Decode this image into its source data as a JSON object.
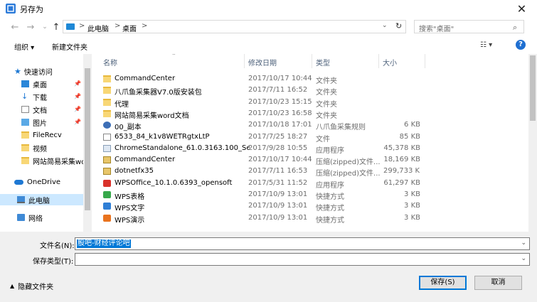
{
  "window": {
    "title": "另存为",
    "close_glyph": "✕"
  },
  "address": {
    "path": [
      "此电脑",
      "桌面"
    ],
    "sep": ">"
  },
  "search": {
    "placeholder": "搜索\"桌面\""
  },
  "toolbar": {
    "organize": "组织 ▾",
    "new_folder": "新建文件夹",
    "view_glyph": "☷ ▾",
    "help_glyph": "?"
  },
  "nav_pane": {
    "items": [
      {
        "label": "快速访问",
        "icon": "star-icon"
      },
      {
        "label": "桌面",
        "icon": "desktop-icon",
        "pinned": true
      },
      {
        "label": "下载",
        "icon": "download-icon",
        "pinned": true
      },
      {
        "label": "文档",
        "icon": "document-icon",
        "pinned": true
      },
      {
        "label": "图片",
        "icon": "pictures-icon",
        "pinned": true
      },
      {
        "label": "FileRecv",
        "icon": "folder-icon"
      },
      {
        "label": "视频",
        "icon": "folder-icon"
      },
      {
        "label": "网站简易采集wc",
        "icon": "folder-icon"
      },
      {
        "label": "OneDrive",
        "icon": "onedrive-icon"
      },
      {
        "label": "此电脑",
        "icon": "this-pc-icon",
        "selected": true
      },
      {
        "label": "网络",
        "icon": "network-icon"
      }
    ]
  },
  "columns": {
    "name": "名称",
    "date": "修改日期",
    "type": "类型",
    "size": "大小"
  },
  "files": [
    {
      "name": "CommandCenter",
      "date": "2017/10/17 10:44",
      "type": "文件夹",
      "size": "",
      "icon": "folder"
    },
    {
      "name": "八爪鱼采集器V7.0版安装包",
      "date": "2017/7/11 16:52",
      "type": "文件夹",
      "size": "",
      "icon": "folder"
    },
    {
      "name": "代理",
      "date": "2017/10/23 15:15",
      "type": "文件夹",
      "size": "",
      "icon": "folder"
    },
    {
      "name": "网站简易采集word文档",
      "date": "2017/10/23 16:58",
      "type": "文件夹",
      "size": "",
      "icon": "folder"
    },
    {
      "name": "00_副本",
      "date": "2017/10/18 17:01",
      "type": "八爪鱼采集规则",
      "size": "6 KB",
      "icon": "rule"
    },
    {
      "name": "6533_84_k1v8WETRgtxLtP",
      "date": "2017/7/25 18:27",
      "type": "文件",
      "size": "85 KB",
      "icon": "doc"
    },
    {
      "name": "ChromeStandalone_61.0.3163.100_Se...",
      "date": "2017/9/28 10:55",
      "type": "应用程序",
      "size": "45,378 KB",
      "icon": "exe"
    },
    {
      "name": "CommandCenter",
      "date": "2017/10/17 10:44",
      "type": "压缩(zipped)文件...",
      "size": "18,169 KB",
      "icon": "zip"
    },
    {
      "name": "dotnetfx35",
      "date": "2017/7/11 16:53",
      "type": "压缩(zipped)文件...",
      "size": "299,733 KB",
      "icon": "zip"
    },
    {
      "name": "WPSOffice_10.1.0.6393_opensoft",
      "date": "2017/5/31 11:52",
      "type": "应用程序",
      "size": "61,297 KB",
      "icon": "wpsr"
    },
    {
      "name": "WPS表格",
      "date": "2017/10/9 13:01",
      "type": "快捷方式",
      "size": "3 KB",
      "icon": "wpsg"
    },
    {
      "name": "WPS文字",
      "date": "2017/10/9 13:01",
      "type": "快捷方式",
      "size": "3 KB",
      "icon": "wpsb"
    },
    {
      "name": "WPS演示",
      "date": "2017/10/9 13:01",
      "type": "快捷方式",
      "size": "3 KB",
      "icon": "wpso"
    }
  ],
  "form": {
    "filename_label": "文件名(N):",
    "filename_value": "股吧-财经评论吧",
    "filetype_label": "保存类型(T):",
    "filetype_value": ""
  },
  "footer": {
    "hide_folders": "隐藏文件夹",
    "save": "保存(S)",
    "cancel": "取消"
  }
}
